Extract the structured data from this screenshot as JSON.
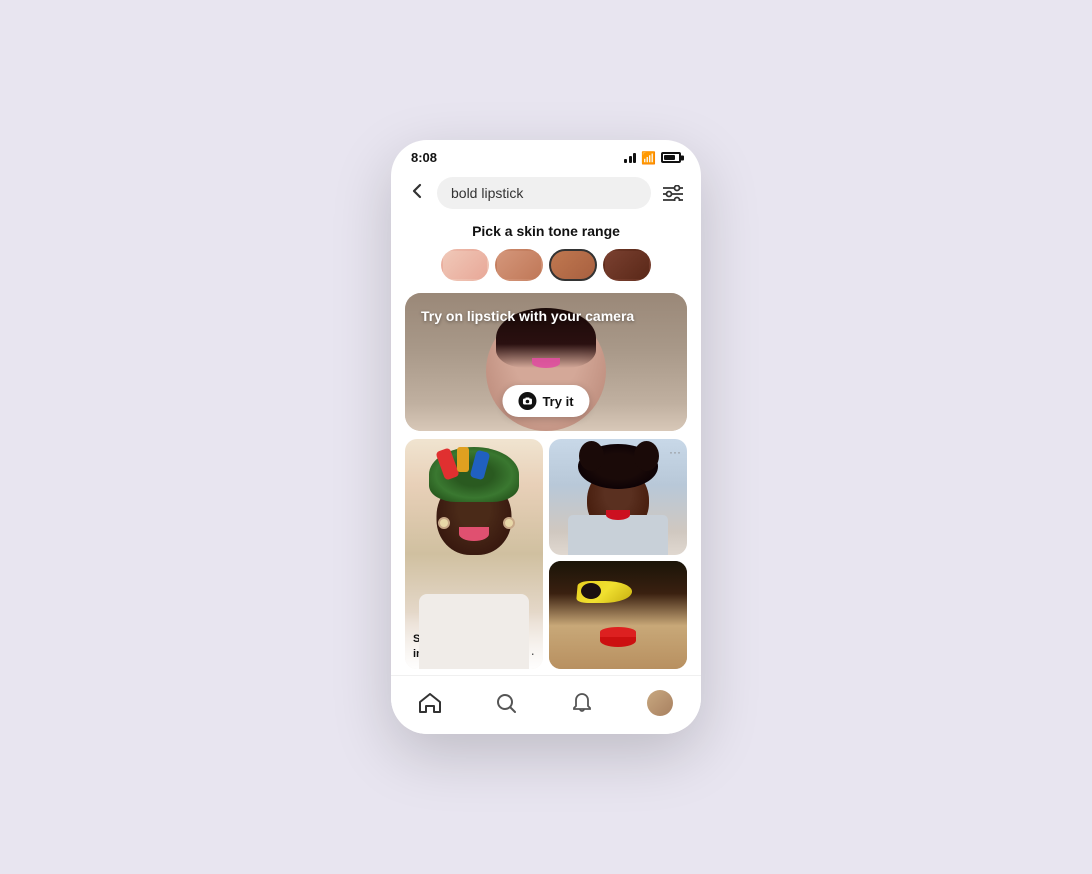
{
  "statusBar": {
    "time": "8:08",
    "signal": "signal-icon",
    "wifi": "wifi-icon",
    "battery": "battery-icon"
  },
  "searchBar": {
    "backLabel": "‹",
    "searchValue": "bold lipstick",
    "searchPlaceholder": "bold lipstick",
    "filterLabel": "filter"
  },
  "skinTone": {
    "title": "Pick a skin tone range",
    "swatches": [
      {
        "color": "#e8b8a8",
        "id": "light"
      },
      {
        "color": "#d4967a",
        "id": "medium-light"
      },
      {
        "color": "#b87050",
        "id": "medium",
        "selected": true
      },
      {
        "color": "#7a4030",
        "id": "deep"
      }
    ]
  },
  "tryOnCard": {
    "overlayText": "Try on lipstick with your camera",
    "buttonLabel": "Try it"
  },
  "pins": [
    {
      "id": "pin-1",
      "title": "Sheer lipstick look inspiration",
      "hasMoreMenu": true,
      "imageType": "woman-colorful-wrap"
    },
    {
      "id": "pin-2",
      "title": "",
      "hasMoreMenu": false,
      "imageType": "woman-curly",
      "hasDotsRight": true
    },
    {
      "id": "pin-3",
      "title": "",
      "hasMoreMenu": false,
      "imageType": "woman-yellow-eye"
    }
  ],
  "bottomNav": {
    "items": [
      {
        "id": "home",
        "icon": "⌂",
        "label": "home"
      },
      {
        "id": "search",
        "icon": "🔍",
        "label": "search"
      },
      {
        "id": "bell",
        "icon": "🔔",
        "label": "notifications"
      },
      {
        "id": "avatar",
        "icon": "",
        "label": "profile"
      }
    ]
  }
}
